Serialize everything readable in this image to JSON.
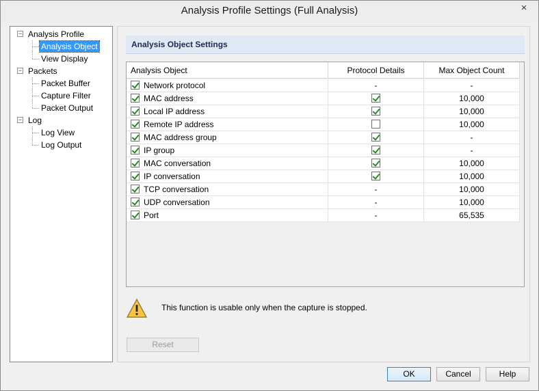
{
  "window": {
    "title": "Analysis Profile Settings (Full Analysis)",
    "close_glyph": "×"
  },
  "tree": {
    "groups": [
      {
        "label": "Analysis Profile",
        "toggle": "−",
        "children": [
          "Analysis Object",
          "View Display"
        ]
      },
      {
        "label": "Packets",
        "toggle": "−",
        "children": [
          "Packet Buffer",
          "Capture Filter",
          "Packet Output"
        ]
      },
      {
        "label": "Log",
        "toggle": "−",
        "children": [
          "Log View",
          "Log Output"
        ]
      }
    ],
    "selected": "Analysis Object"
  },
  "panel": {
    "header": "Analysis Object Settings",
    "columns": [
      "Analysis Object",
      "Protocol Details",
      "Max Object Count"
    ],
    "rows": [
      {
        "name": "Network protocol",
        "enabled": true,
        "details": "-",
        "max": "-"
      },
      {
        "name": "MAC address",
        "enabled": true,
        "details": true,
        "max": "10,000"
      },
      {
        "name": "Local IP address",
        "enabled": true,
        "details": true,
        "max": "10,000"
      },
      {
        "name": "Remote IP address",
        "enabled": true,
        "details": false,
        "max": "10,000"
      },
      {
        "name": "MAC address group",
        "enabled": true,
        "details": true,
        "max": "-"
      },
      {
        "name": "IP group",
        "enabled": true,
        "details": true,
        "max": "-"
      },
      {
        "name": "MAC conversation",
        "enabled": true,
        "details": true,
        "max": "10,000"
      },
      {
        "name": "IP conversation",
        "enabled": true,
        "details": true,
        "max": "10,000"
      },
      {
        "name": "TCP conversation",
        "enabled": true,
        "details": "-",
        "max": "10,000"
      },
      {
        "name": "UDP conversation",
        "enabled": true,
        "details": "-",
        "max": "10,000"
      },
      {
        "name": "Port",
        "enabled": true,
        "details": "-",
        "max": "65,535"
      }
    ],
    "warning": "This function is usable only when the capture is stopped.",
    "warning_icon": "warning-triangle-icon",
    "reset_label": "Reset"
  },
  "footer": {
    "ok_label": "OK",
    "cancel_label": "Cancel",
    "help_label": "Help"
  }
}
